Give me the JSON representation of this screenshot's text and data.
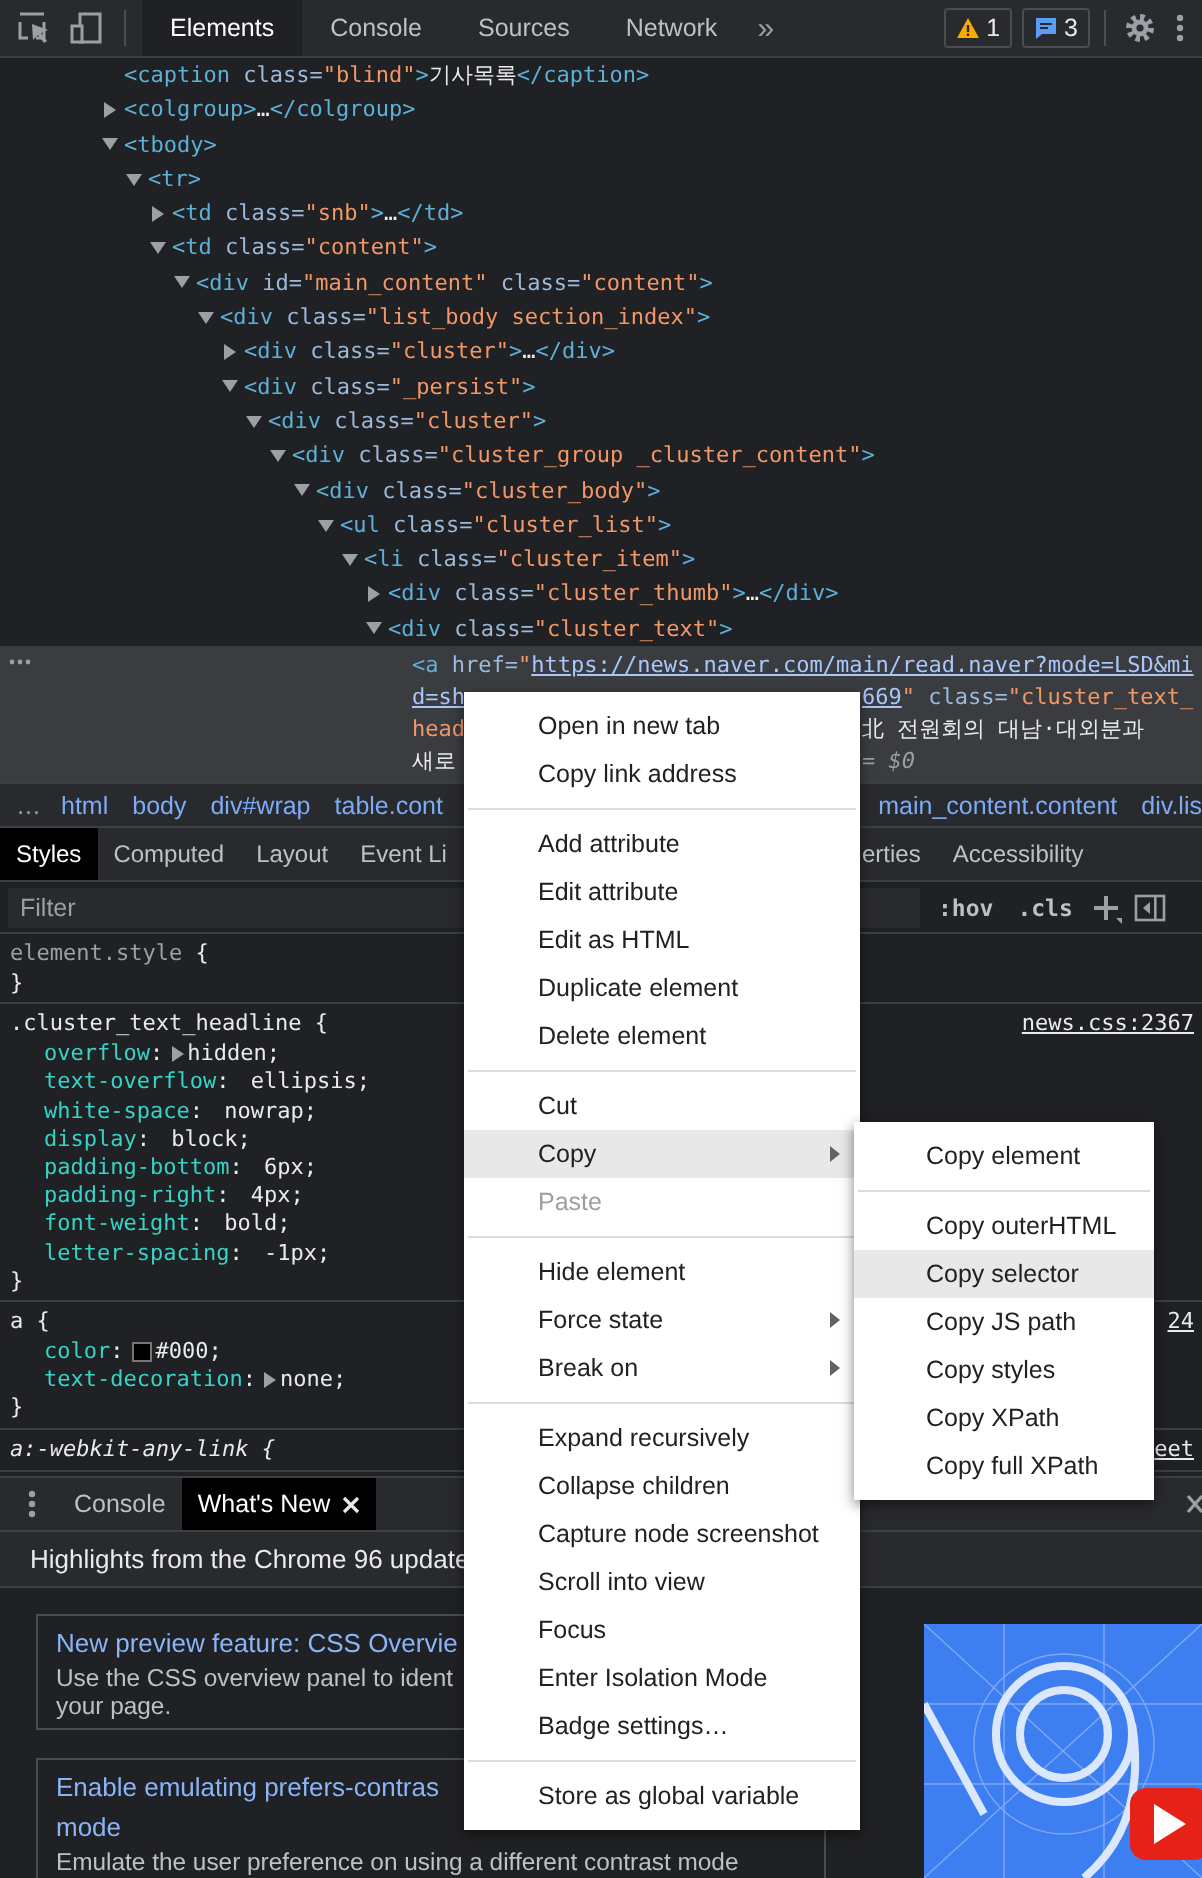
{
  "toolbar": {
    "tabs": [
      {
        "label": "Elements",
        "selected": true
      },
      {
        "label": "Console",
        "selected": false
      },
      {
        "label": "Sources",
        "selected": false
      },
      {
        "label": "Network",
        "selected": false
      }
    ],
    "more_tabs": "»",
    "warnings": "1",
    "messages": "3"
  },
  "elements_tree": [
    {
      "markup": "<caption class=\"blind\">기사목록</caption>",
      "kind": "leaf",
      "selected": false
    },
    {
      "markup": "<colgroup>…</colgroup>",
      "kind": "branch",
      "expanded": false,
      "selected": false
    },
    {
      "markup": "<tbody>",
      "kind": "branch",
      "expanded": true,
      "selected": false,
      "children": [
        {
          "markup": "<tr>",
          "kind": "branch",
          "expanded": true,
          "selected": false,
          "children": [
            {
              "markup": "<td class=\"snb\">…</td>",
              "kind": "branch",
              "expanded": false,
              "selected": false
            },
            {
              "markup": "<td class=\"content\">",
              "kind": "branch",
              "expanded": true,
              "selected": false,
              "children": [
                {
                  "markup": "<div id=\"main_content\" class=\"content\">",
                  "kind": "branch",
                  "expanded": true,
                  "selected": false,
                  "children": [
                    {
                      "markup": "<div class=\"list_body section_index\">",
                      "kind": "branch",
                      "expanded": true,
                      "selected": false,
                      "children": [
                        {
                          "markup": "<div class=\"cluster\">…</div>",
                          "kind": "branch",
                          "expanded": false,
                          "selected": false
                        },
                        {
                          "markup": "<div class=\"_persist\">",
                          "kind": "branch",
                          "expanded": true,
                          "selected": false,
                          "children": [
                            {
                              "markup": "<div class=\"cluster\">",
                              "kind": "branch",
                              "expanded": true,
                              "selected": false,
                              "children": [
                                {
                                  "markup": "<div class=\"cluster_group _cluster_content\">",
                                  "kind": "branch",
                                  "expanded": true,
                                  "selected": false,
                                  "children": [
                                    {
                                      "markup": "<div class=\"cluster_body\">",
                                      "kind": "branch",
                                      "expanded": true,
                                      "selected": false,
                                      "children": [
                                        {
                                          "markup": "<ul class=\"cluster_list\">",
                                          "kind": "branch",
                                          "expanded": true,
                                          "selected": false,
                                          "children": [
                                            {
                                              "markup": "<li class=\"cluster_item\">",
                                              "kind": "branch",
                                              "expanded": true,
                                              "selected": false,
                                              "children": [
                                                {
                                                  "markup": "<div class=\"cluster_thumb\">…</div>",
                                                  "kind": "branch",
                                                  "expanded": false,
                                                  "selected": false
                                                },
                                                {
                                                  "markup": "<div class=\"cluster_text\">",
                                                  "kind": "branch",
                                                  "expanded": true,
                                                  "selected": false,
                                                  "children": [
                                                    {
                                                      "kind": "split",
                                                      "selected": true,
                                                      "lines": [
                                                        {
                                                          "left": [
                                                            {
                                                              "kind": "tag",
                                                              "text": "<a"
                                                            },
                                                            {
                                                              "kind": "attr",
                                                              "text": " href="
                                                            },
                                                            {
                                                              "kind": "value",
                                                              "text": "\""
                                                            },
                                                            {
                                                              "kind": "link",
                                                              "text": "https://news.naver.com/main/read.naver?mode=LSD&mi"
                                                            }
                                                          ]
                                                        },
                                                        {
                                                          "left": [
                                                            {
                                                              "kind": "link",
                                                              "text": "d=sh"
                                                            }
                                                          ],
                                                          "right": [
                                                            {
                                                              "kind": "link",
                                                              "text": "669"
                                                            },
                                                            {
                                                              "kind": "value",
                                                              "text": "\""
                                                            },
                                                            {
                                                              "kind": "attr",
                                                              "text": " class="
                                                            },
                                                            {
                                                              "kind": "value",
                                                              "text": "\"cluster_text_"
                                                            }
                                                          ]
                                                        },
                                                        {
                                                          "left": [
                                                            {
                                                              "kind": "value",
                                                              "text": "head"
                                                            }
                                                          ],
                                                          "right": [
                                                            {
                                                              "kind": "text",
                                                              "text": "北 전원회의 대남·대외분과"
                                                            }
                                                          ]
                                                        },
                                                        {
                                                          "left": [
                                                            {
                                                              "kind": "text",
                                                              "text": "새로"
                                                            }
                                                          ],
                                                          "right": [
                                                            {
                                                              "kind": "dim",
                                                              "text": "= $0"
                                                            }
                                                          ]
                                                        }
                                                      ]
                                                    }
                                                  ]
                                                }
                                              ]
                                            }
                                          ]
                                        }
                                      ]
                                    }
                                  ]
                                }
                              ]
                            }
                          ]
                        }
                      ]
                    }
                  ]
                }
              ]
            }
          ]
        }
      ]
    }
  ],
  "breadcrumbs": {
    "more": "…",
    "left": [
      "html",
      "body",
      "div#wrap",
      "table.cont"
    ],
    "right": [
      "main_content.content",
      "div.lis"
    ]
  },
  "styles_tabs": {
    "left": [
      {
        "label": "Styles",
        "selected": true
      },
      {
        "label": "Computed",
        "selected": false
      },
      {
        "label": "Layout",
        "selected": false
      },
      {
        "label": "Event Li",
        "selected": false
      }
    ],
    "right": [
      {
        "label": "erties",
        "selected": false
      },
      {
        "label": "Accessibility",
        "selected": false
      }
    ]
  },
  "filter": {
    "placeholder": "Filter",
    "hov": ":hov",
    "cls": ".cls"
  },
  "rules": [
    {
      "kind": "inline",
      "selector": "element.style",
      "open": " {",
      "close": "}"
    },
    {
      "kind": "rule",
      "selector": ".cluster_text_headline",
      "open": " {",
      "close": "}",
      "source": "news.css:2367",
      "props": [
        {
          "name": "overflow",
          "colon": ":",
          "value": "hidden;",
          "expandable": true
        },
        {
          "name": "text-overflow",
          "colon": ":",
          "value": "ellipsis;",
          "expandable": false
        },
        {
          "name": "white-space",
          "colon": ":",
          "value": "nowrap;",
          "expandable": false
        },
        {
          "name": "display",
          "colon": ":",
          "value": "block;",
          "expandable": false
        },
        {
          "name": "padding-bottom",
          "colon": ":",
          "value": "6px;",
          "expandable": false
        },
        {
          "name": "padding-right",
          "colon": ":",
          "value": "4px;",
          "expandable": false
        },
        {
          "name": "font-weight",
          "colon": ":",
          "value": "bold;",
          "expandable": false
        },
        {
          "name": "letter-spacing",
          "colon": ":",
          "value": "-1px;",
          "expandable": false
        }
      ]
    },
    {
      "kind": "rule",
      "selector": "a",
      "open": " {",
      "close": "}",
      "source": "24",
      "props": [
        {
          "name": "color",
          "colon": ":",
          "value": "#000;",
          "expandable": false,
          "swatch": true
        },
        {
          "name": "text-decoration",
          "colon": ":",
          "value": "none;",
          "expandable": true
        }
      ]
    },
    {
      "kind": "useragent",
      "selector": "a:-webkit-any-link",
      "open": " {",
      "source": "eet"
    }
  ],
  "drawer": {
    "tabs": [
      {
        "label": "Console",
        "selected": false,
        "closable": false
      },
      {
        "label": "What's New",
        "selected": true,
        "closable": true
      }
    ],
    "heading": "Highlights from the Chrome 96 update",
    "cards": [
      {
        "title_lines": [
          "New preview feature: CSS Overvie"
        ],
        "text_lines": [
          "Use the CSS overview panel to ident",
          "your page."
        ]
      },
      {
        "title_lines": [
          "Enable emulating prefers-contras",
          "mode"
        ],
        "text_lines": [
          "Emulate the user preference on using a different contrast mode"
        ]
      }
    ]
  },
  "context_menu": {
    "groups": [
      [
        {
          "label": "Open in new tab",
          "submenu": false,
          "disabled": false,
          "selected": false
        },
        {
          "label": "Copy link address",
          "submenu": false,
          "disabled": false,
          "selected": false
        }
      ],
      [
        {
          "label": "Add attribute",
          "submenu": false,
          "disabled": false,
          "selected": false
        },
        {
          "label": "Edit attribute",
          "submenu": false,
          "disabled": false,
          "selected": false
        },
        {
          "label": "Edit as HTML",
          "submenu": false,
          "disabled": false,
          "selected": false
        },
        {
          "label": "Duplicate element",
          "submenu": false,
          "disabled": false,
          "selected": false
        },
        {
          "label": "Delete element",
          "submenu": false,
          "disabled": false,
          "selected": false
        }
      ],
      [
        {
          "label": "Cut",
          "submenu": false,
          "disabled": false,
          "selected": false
        },
        {
          "label": "Copy",
          "submenu": true,
          "disabled": false,
          "selected": true
        },
        {
          "label": "Paste",
          "submenu": false,
          "disabled": true,
          "selected": false
        }
      ],
      [
        {
          "label": "Hide element",
          "submenu": false,
          "disabled": false,
          "selected": false
        },
        {
          "label": "Force state",
          "submenu": true,
          "disabled": false,
          "selected": false
        },
        {
          "label": "Break on",
          "submenu": true,
          "disabled": false,
          "selected": false
        }
      ],
      [
        {
          "label": "Expand recursively",
          "submenu": false,
          "disabled": false,
          "selected": false
        },
        {
          "label": "Collapse children",
          "submenu": false,
          "disabled": false,
          "selected": false
        },
        {
          "label": "Capture node screenshot",
          "submenu": false,
          "disabled": false,
          "selected": false
        },
        {
          "label": "Scroll into view",
          "submenu": false,
          "disabled": false,
          "selected": false
        },
        {
          "label": "Focus",
          "submenu": false,
          "disabled": false,
          "selected": false
        },
        {
          "label": "Enter Isolation Mode",
          "submenu": false,
          "disabled": false,
          "selected": false
        },
        {
          "label": "Badge settings…",
          "submenu": false,
          "disabled": false,
          "selected": false
        }
      ],
      [
        {
          "label": "Store as global variable",
          "submenu": false,
          "disabled": false,
          "selected": false
        }
      ]
    ]
  },
  "copy_submenu": {
    "groups": [
      [
        {
          "label": "Copy element",
          "submenu": false,
          "disabled": false,
          "selected": false
        }
      ],
      [
        {
          "label": "Copy outerHTML",
          "submenu": false,
          "disabled": false,
          "selected": false
        },
        {
          "label": "Copy selector",
          "submenu": false,
          "disabled": false,
          "selected": true
        },
        {
          "label": "Copy JS path",
          "submenu": false,
          "disabled": false,
          "selected": false
        },
        {
          "label": "Copy styles",
          "submenu": false,
          "disabled": false,
          "selected": false
        },
        {
          "label": "Copy XPath",
          "submenu": false,
          "disabled": false,
          "selected": false
        },
        {
          "label": "Copy full XPath",
          "submenu": false,
          "disabled": false,
          "selected": false
        }
      ]
    ]
  }
}
